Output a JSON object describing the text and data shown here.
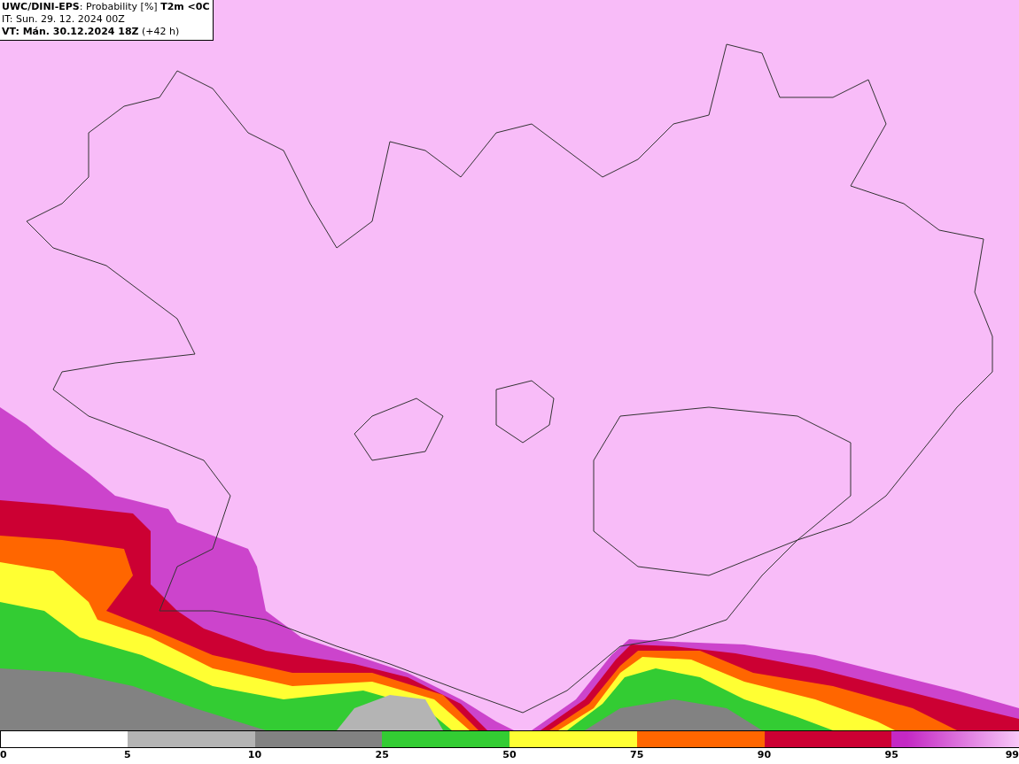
{
  "header": {
    "title": "**UWC/DINI-EPS**: Probability [%] **T2m <0C**",
    "initial_time": "IT: Sun. 29. 12. 2024 00Z",
    "valid_time": "**VT: Mán. 30.12.2024 18Z** (+42 h)"
  },
  "legend": {
    "segments": [
      {
        "color": "#ffffff"
      },
      {
        "color": "#b4b4b4"
      },
      {
        "color": "#828282"
      },
      {
        "color": "#33cc33"
      },
      {
        "color": "#ffff33"
      },
      {
        "color": "#ff6600"
      },
      {
        "color": "#cc0033"
      },
      {
        "color": "#c428c4"
      }
    ],
    "ticks": [
      "0",
      "5",
      "10",
      "25",
      "50",
      "75",
      "90",
      "95",
      "99"
    ]
  }
}
